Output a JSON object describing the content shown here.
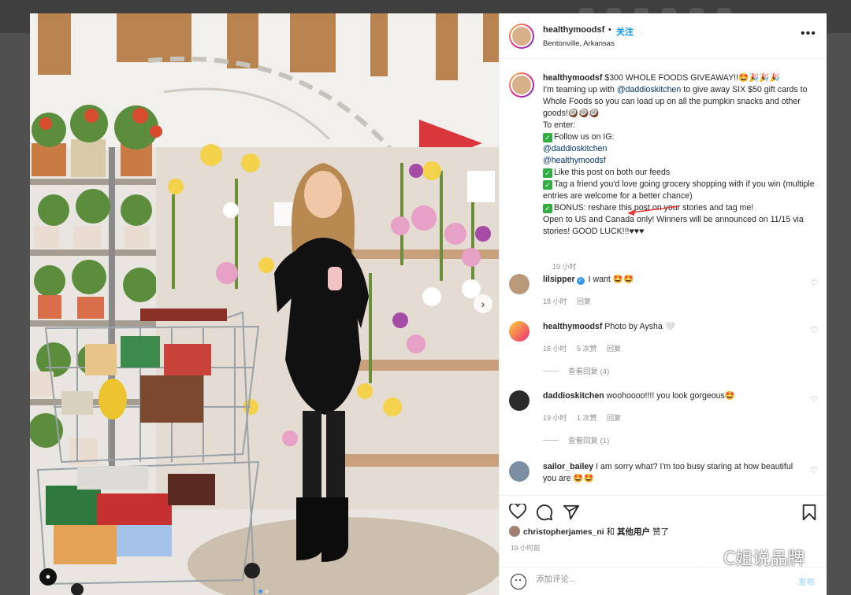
{
  "post": {
    "username": "healthymoodsf",
    "follow_separator": "•",
    "follow_label": "关注",
    "location": "Bentonville, Arkansas",
    "more": "•••"
  },
  "caption": {
    "username": "healthymoodsf",
    "line1": "$300 WHOLE FOODS GIVEAWAY!!🤩🎉🎉🎉",
    "line2a": "I'm teaming up with ",
    "line2_mention": "@daddioskitchen",
    "line2b": " to give away SIX $50 gift cards to Whole Foods so you can load up on all the pumpkin snacks and other goods!🥥🥥🥥",
    "to_enter": "To enter:",
    "step1": "Follow us on IG:",
    "mention1": "@daddioskitchen",
    "mention2": "@healthymoodsf",
    "step2": "Like this post on both our feeds",
    "step3": "Tag a friend you'd love going grocery shopping with if you win (multiple entries are welcome for a better chance)",
    "step4": "BONUS: reshare this post on your stories and tag me!",
    "closing": "Open to US and Canada only! Winners will be announced on 11/15 via stories! GOOD LUCK!!!♥♥♥",
    "time": "19 小时"
  },
  "comments": [
    {
      "user": "lilsipper",
      "verified": true,
      "text": "I want 🤩🤩",
      "time": "18 小时",
      "likes": "",
      "reply": "回复",
      "view_replies": ""
    },
    {
      "user": "healthymoodsf",
      "verified": false,
      "text": "Photo by Aysha 🤍",
      "time": "18 小时",
      "likes": "5 次赞",
      "reply": "回复",
      "view_replies": "查看回复 (4)"
    },
    {
      "user": "daddioskitchen",
      "verified": false,
      "text": "woohoooo!!!! you look gorgeous🤩",
      "time": "19 小时",
      "likes": "1 次赞",
      "reply": "回复",
      "view_replies": "查看回复 (1)"
    },
    {
      "user": "sailor_bailey",
      "verified": false,
      "text": "I am sorry what? I'm too busy staring at how beautiful you are 🤩🤩",
      "time": "",
      "likes": "",
      "reply": "",
      "view_replies": ""
    }
  ],
  "likes": {
    "user": "christopherjames_ni",
    "suffix": " 和 ",
    "others": "其他用户",
    "liked": " 赞了"
  },
  "post_time": "19 小时前",
  "add_comment": {
    "placeholder": "添加评论...",
    "post": "发布"
  },
  "watermark": "C姐说品牌",
  "icons": [
    "more-icon",
    "heart-icon",
    "comment-icon",
    "share-icon",
    "bookmark-icon",
    "emoji-icon",
    "next-arrow-icon",
    "user-tag-icon"
  ],
  "colors": {
    "link": "#0095f6",
    "mention": "#00376b",
    "meta": "#8e8e8e",
    "text": "#262626"
  }
}
